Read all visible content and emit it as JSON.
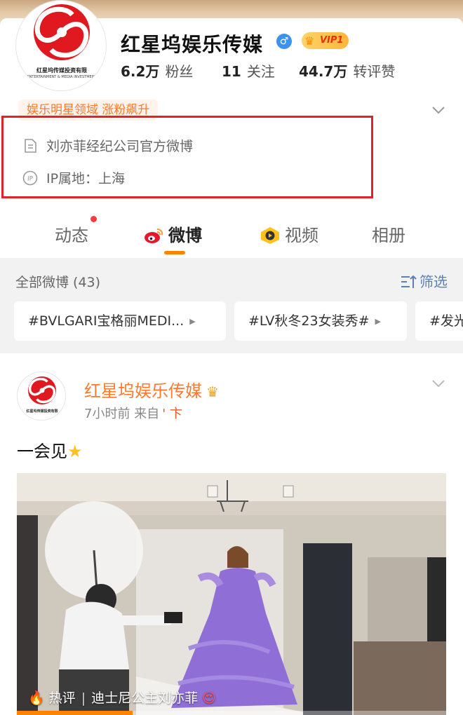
{
  "profile": {
    "name": "红星坞娱乐传媒",
    "gender_icon": "male-icon",
    "vip_label": "VIP1",
    "stats": [
      {
        "value": "6.2万",
        "label": "粉丝"
      },
      {
        "value": "11",
        "label": "关注"
      },
      {
        "value": "44.7万",
        "label": "转评赞"
      }
    ],
    "tag": "娱乐明星领域 涨粉飙升",
    "description": "刘亦菲经纪公司官方微博",
    "ip_location": "IP属地：上海",
    "logo_text": "红星坞传媒投资有限",
    "logo_sub": "ENTERTAINMENT & MEDIA INVESTMENT"
  },
  "tabs": [
    {
      "label": "动态",
      "icon": "",
      "has_dot": true
    },
    {
      "label": "微博",
      "icon": "weibo-icon",
      "active": true
    },
    {
      "label": "视频",
      "icon": "video-icon"
    },
    {
      "label": "相册",
      "icon": ""
    }
  ],
  "filter": {
    "all_count": "全部微博 (43)",
    "filter_label": "筛选",
    "chips": [
      "#BVLGARI宝格丽MEDI...",
      "#LV秋冬23女装秀#",
      "#发光"
    ]
  },
  "post": {
    "author": "红星坞娱乐传媒",
    "time": "7小时前",
    "source_prefix": "来自",
    "source": "' 卞",
    "text": "一会见",
    "hot_label": "热评",
    "hot_text": "迪士尼公主刘亦菲",
    "video_progress": 0.27
  },
  "colors": {
    "accent": "#ff8200",
    "highlight_box": "#e0222a",
    "link_blue": "#5b7fb7",
    "orange_text": "#ff7a2f"
  }
}
